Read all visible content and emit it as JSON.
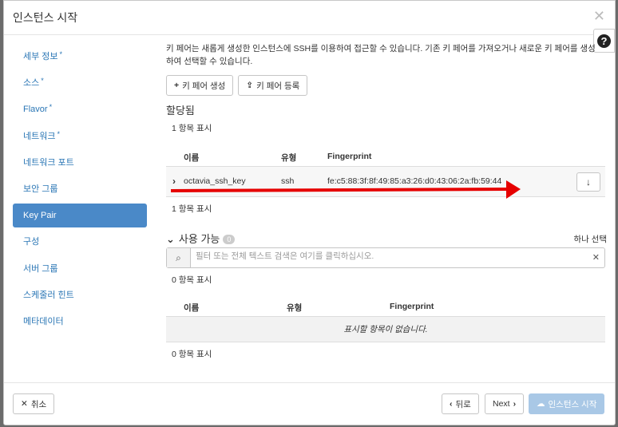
{
  "modal": {
    "title": "인스턴스 시작"
  },
  "sidebar": {
    "items": [
      {
        "label": "세부 정보",
        "required": "*"
      },
      {
        "label": "소스",
        "required": "*"
      },
      {
        "label": "Flavor",
        "required": "*"
      },
      {
        "label": "네트워크",
        "required": "*"
      },
      {
        "label": "네트워크 포트"
      },
      {
        "label": "보안 그룹"
      },
      {
        "label": "Key Pair"
      },
      {
        "label": "구성"
      },
      {
        "label": "서버 그룹"
      },
      {
        "label": "스케줄러 힌트"
      },
      {
        "label": "메타데이터"
      }
    ]
  },
  "content": {
    "description": "키 페어는 새롭게 생성한 인스턴스에 SSH를 이용하여 접근할 수 있습니다. 기존 키 페어를 가져오거나 새로운 키 페어를 생성하여 선택할 수 있습니다.",
    "create_button": "키 페어 생성",
    "import_button": "키 페어 등록",
    "allocated": {
      "title": "할당됨",
      "count": "1 항목 표시",
      "count_bottom": "1 항목 표시",
      "columns": [
        "이름",
        "유형",
        "Fingerprint"
      ],
      "rows": [
        {
          "name": "octavia_ssh_key",
          "type": "ssh",
          "fingerprint": "fe:c5:88:3f:8f:49:85:a3:26:d0:43:06:2a:fb:59:44"
        }
      ]
    },
    "available": {
      "title": "사용 가능",
      "badge": "0",
      "select_one": "하나 선택",
      "search_placeholder": "필터 또는 전체 텍스트 검색은 여기를 클릭하십시오.",
      "count": "0 항목 표시",
      "count_bottom": "0 항목 표시",
      "columns": [
        "이름",
        "유형",
        "Fingerprint"
      ],
      "empty_text": "표시할 항목이 없습니다."
    }
  },
  "footer": {
    "cancel": "취소",
    "back": "뒤로",
    "next": "Next",
    "launch": "인스턴스 시작"
  },
  "colors": {
    "accent": "#4a89c8",
    "arrow": "#e60000"
  }
}
